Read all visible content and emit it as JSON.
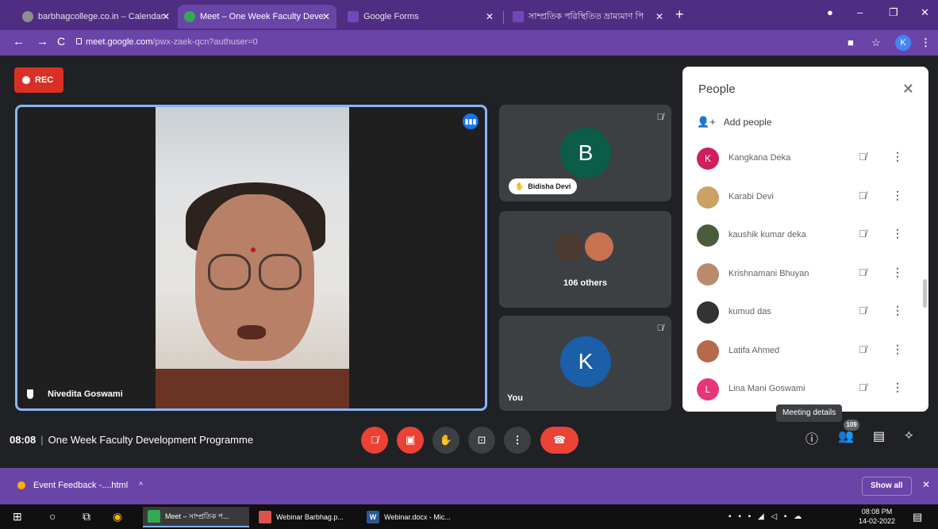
{
  "browser": {
    "tabs": [
      {
        "label": "barbhagcollege.co.in – Calendar",
        "icon": "web-icon",
        "color": "#8e8e8e"
      },
      {
        "label": "Meet – One Week Faculty Deve",
        "icon": "meet-icon",
        "color": "#34a853"
      },
      {
        "label": "Google Forms",
        "icon": "forms-icon",
        "color": "#7248b9"
      },
      {
        "label": "সাম্প্রতিক পরিস্থিতিত ভ্রাম্যমাণ পি",
        "icon": "forms-icon",
        "color": "#7248b9"
      }
    ],
    "url_host": "meet.google.com",
    "url_path": "/pwx-zaek-qcn?authuser=0",
    "profile_initial": "K"
  },
  "meet": {
    "rec_label": "REC",
    "main_speaker": "Nivedita Goswami",
    "tiles": {
      "bidisha": {
        "initial": "B",
        "name": "Bidisha Devi",
        "color": "#0b5d47"
      },
      "others": {
        "label": "106 others"
      },
      "you": {
        "initial": "K",
        "label": "You",
        "color": "#1a5fa8"
      }
    },
    "meeting_time": "08:08",
    "meeting_title": "One Week Faculty Development Programme",
    "tooltip": "Meeting details",
    "participant_count": "109"
  },
  "people_panel": {
    "title": "People",
    "add_people": "Add people",
    "participants": [
      {
        "name": "Kangkana Deka",
        "initial": "K",
        "color": "#d01f5e"
      },
      {
        "name": "Karabi Devi",
        "initial": "",
        "color": "#c9a264"
      },
      {
        "name": "kaushik kumar deka",
        "initial": "",
        "color": "#4a5c3a"
      },
      {
        "name": "Krishnamani Bhuyan",
        "initial": "",
        "color": "#b88a6e"
      },
      {
        "name": "kumud das",
        "initial": "",
        "color": "#333333"
      },
      {
        "name": "Latifa Ahmed",
        "initial": "",
        "color": "#b56a4a"
      },
      {
        "name": "Lina Mani Goswami",
        "initial": "L",
        "color": "#e8357a"
      }
    ]
  },
  "downloads": {
    "item": "Event Feedback -....html",
    "show_all": "Show all"
  },
  "taskbar": {
    "apps": [
      {
        "label": "Meet – সাম্প্রতিক প...",
        "icon_color": "#34a853",
        "glyph": ""
      },
      {
        "label": "Webinar Barbhag.p...",
        "icon_color": "#d9534f",
        "glyph": ""
      },
      {
        "label": "Webinar.docx - Mic...",
        "icon_color": "#2b5797",
        "glyph": "W"
      }
    ],
    "time": "08:08 PM",
    "date": "14-02-2022"
  }
}
